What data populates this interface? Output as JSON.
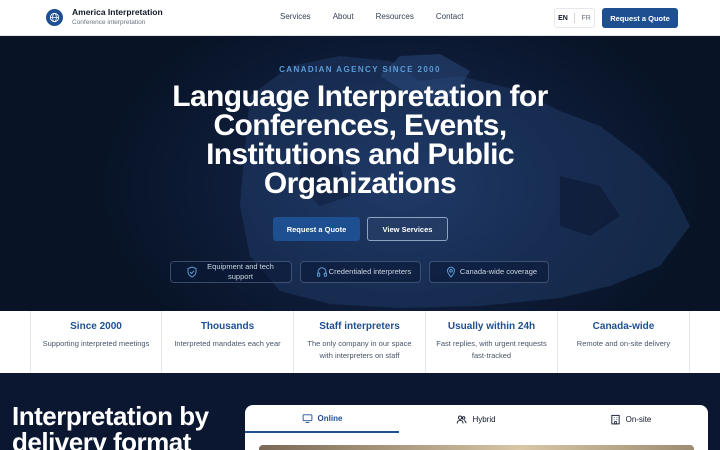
{
  "header": {
    "brand_name": "America Interpretation",
    "brand_subtitle": "Conference interpretation",
    "nav": [
      "Services",
      "About",
      "Resources",
      "Contact"
    ],
    "lang_en": "EN",
    "lang_fr": "FR",
    "cta": "Request a Quote"
  },
  "hero": {
    "eyebrow": "CANADIAN AGENCY SINCE 2000",
    "title": "Language Interpretation for Conferences, Events, Institutions and Public Organizations",
    "primary_button": "Request a Quote",
    "secondary_button": "View Services",
    "features": [
      {
        "icon": "shield-check-icon",
        "label": "Equipment and tech support"
      },
      {
        "icon": "headphones-icon",
        "label": "Credentialed interpreters"
      },
      {
        "icon": "map-pin-icon",
        "label": "Canada-wide coverage"
      }
    ]
  },
  "stats": [
    {
      "value": "Since 2000",
      "desc": "Supporting interpreted meetings"
    },
    {
      "value": "Thousands",
      "desc": "Interpreted mandates each year"
    },
    {
      "value": "Staff interpreters",
      "desc": "The only company in our space with interpreters on staff"
    },
    {
      "value": "Usually within 24h",
      "desc": "Fast replies, with urgent requests fast-tracked"
    },
    {
      "value": "Canada-wide",
      "desc": "Remote and on-site delivery"
    }
  ],
  "delivery": {
    "title": "Interpretation by delivery format",
    "tabs": [
      {
        "icon": "monitor-icon",
        "label": "Online"
      },
      {
        "icon": "users-icon",
        "label": "Hybrid"
      },
      {
        "icon": "building-icon",
        "label": "On-site"
      }
    ],
    "active_tab": "Online"
  },
  "colors": {
    "brand": "#1e4f91",
    "hero_bg": "#0e1d3a",
    "eyebrow": "#5b9bd5"
  }
}
